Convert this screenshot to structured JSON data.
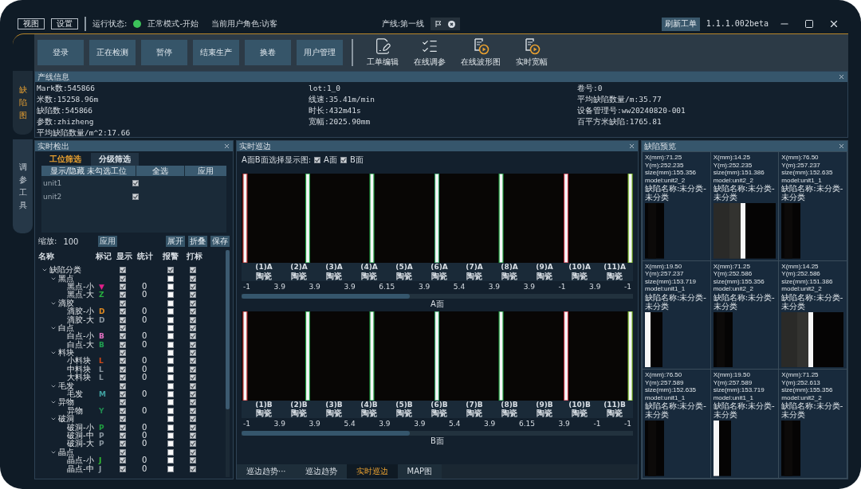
{
  "menu": [
    "视图",
    "设置"
  ],
  "status": {
    "label": "运行状态:",
    "state": "正常模式-开始",
    "running": true
  },
  "role": "当前用户角色:访客",
  "line": "产线:第一线",
  "refresh_button": "刷新工单",
  "version": "1.1.1.002beta",
  "actions": [
    "登录",
    "正在检测",
    "暂停",
    "结束生产",
    "换卷",
    "用户管理"
  ],
  "tools": [
    {
      "label": "工单编辑",
      "kind": "edit"
    },
    {
      "label": "在线调参",
      "kind": "list"
    },
    {
      "label": "在线波形图",
      "kind": "play"
    },
    {
      "label": "实时宽幅",
      "kind": "play"
    }
  ],
  "side_tabs": [
    {
      "label": "缺陷图",
      "selected": true
    },
    {
      "label": "调参工具",
      "selected": false
    }
  ],
  "info": {
    "title": "产线信息",
    "columns": [
      [
        "Mark数:545866",
        "米数:15258.96m",
        "缺陷数:545866",
        "参数:zhizheng",
        "平均缺陷数量/m^2:17.66"
      ],
      [
        "lot:1_0",
        "线速:35.41m/min",
        "时长:432m41s",
        "宽幅:2025.90mm"
      ],
      [
        "卷号:0",
        "平均缺陷数量/m:35.77",
        "设备管理号:ww20240820-001",
        "百平方米缺陷:1765.81"
      ]
    ]
  },
  "detect": {
    "title": "实时检出",
    "tabs": [
      {
        "label": "工位筛选",
        "selected": true
      },
      {
        "label": "分级筛选",
        "selected": false
      }
    ],
    "filter_columns": [
      "显示/隐藏 未勾选工位",
      "全选",
      "应用"
    ],
    "units": [
      {
        "name": "unit1",
        "checked": true
      },
      {
        "name": "unit2",
        "checked": true
      }
    ],
    "zoom_label": "缩放:",
    "zoom_value": "100",
    "zoom_apply": "应用",
    "buttons": [
      "展开",
      "折叠",
      "保存"
    ],
    "tree_columns": [
      "名称",
      "标记",
      "显示",
      "统计",
      "报警",
      "打标"
    ],
    "tree": [
      {
        "name": "缺陷分类",
        "expanded": true,
        "show": true,
        "alarm": true,
        "mark": true,
        "children": [
          {
            "name": "黑点",
            "expanded": true,
            "show": true,
            "alarm": false,
            "mark": true,
            "children": [
              {
                "name": "黑点-小",
                "symbol": "▼",
                "color": "#e0208a",
                "count": "0",
                "show": true,
                "alarm": false,
                "mark": true
              },
              {
                "name": "黑点-大",
                "symbol": "Z",
                "color": "#28b040",
                "count": "0",
                "show": true,
                "alarm": false,
                "mark": true
              }
            ]
          },
          {
            "name": "滴胶",
            "expanded": true,
            "show": true,
            "alarm": false,
            "mark": true,
            "children": [
              {
                "name": "滴胶-小",
                "symbol": "D",
                "color": "#e08a20",
                "count": "0",
                "show": true,
                "alarm": false,
                "mark": true
              },
              {
                "name": "滴胶-大",
                "symbol": "D",
                "color": "#8a96a0",
                "count": "0",
                "show": true,
                "alarm": false,
                "mark": true
              }
            ]
          },
          {
            "name": "白点",
            "expanded": true,
            "show": true,
            "alarm": false,
            "mark": true,
            "children": [
              {
                "name": "白点-小",
                "symbol": "B",
                "color": "#e070c0",
                "count": "0",
                "show": true,
                "alarm": false,
                "mark": true
              },
              {
                "name": "白点-大",
                "symbol": "B",
                "color": "#20a050",
                "count": "0",
                "show": true,
                "alarm": false,
                "mark": true
              }
            ]
          },
          {
            "name": "料块",
            "expanded": true,
            "show": true,
            "alarm": false,
            "mark": true,
            "children": [
              {
                "name": "小料块",
                "symbol": "L",
                "color": "#d04818",
                "count": "0",
                "show": true,
                "alarm": false,
                "mark": true
              },
              {
                "name": "中料块",
                "symbol": "L",
                "color": "#8a96a0",
                "count": "0",
                "show": true,
                "alarm": false,
                "mark": true
              },
              {
                "name": "大料块",
                "symbol": "L",
                "color": "#8a96a0",
                "count": "0",
                "show": true,
                "alarm": false,
                "mark": true
              }
            ]
          },
          {
            "name": "毛发",
            "expanded": true,
            "show": true,
            "alarm": false,
            "mark": true,
            "children": [
              {
                "name": "毛发",
                "symbol": "M",
                "color": "#40a0a0",
                "count": "0",
                "show": true,
                "alarm": false,
                "mark": true
              }
            ]
          },
          {
            "name": "异物",
            "expanded": true,
            "show": true,
            "alarm": false,
            "mark": true,
            "children": [
              {
                "name": "异物",
                "symbol": "Y",
                "color": "#208a50",
                "count": "0",
                "show": true,
                "alarm": false,
                "mark": true
              }
            ]
          },
          {
            "name": "破洞",
            "expanded": true,
            "show": true,
            "alarm": false,
            "mark": true,
            "children": [
              {
                "name": "破洞-小",
                "symbol": "P",
                "color": "#20a040",
                "count": "0",
                "show": true,
                "alarm": false,
                "mark": true
              },
              {
                "name": "破洞-中",
                "symbol": "P",
                "color": "#8a96a0",
                "count": "0",
                "show": true,
                "alarm": false,
                "mark": true
              },
              {
                "name": "破洞-大",
                "symbol": "P",
                "color": "#8a96a0",
                "count": "0",
                "show": true,
                "alarm": false,
                "mark": true
              }
            ]
          },
          {
            "name": "晶点",
            "expanded": true,
            "show": true,
            "alarm": false,
            "mark": true,
            "children": [
              {
                "name": "晶点-小",
                "symbol": "J",
                "color": "#30c030",
                "count": "0",
                "show": true,
                "alarm": false,
                "mark": true
              },
              {
                "name": "晶点-中",
                "symbol": "J",
                "color": "#8a96a0",
                "count": "0",
                "show": true,
                "alarm": false,
                "mark": true
              }
            ]
          }
        ]
      }
    ]
  },
  "edge": {
    "title": "实时巡边",
    "select_label": "A面B面选择显示图:",
    "faces": [
      {
        "label": "A面",
        "checked": true
      },
      {
        "label": "B面",
        "checked": true
      }
    ],
    "strips": [
      {
        "caption": "A面",
        "labels": [
          [
            "(1)A",
            "陶瓷"
          ],
          [
            "(2)A",
            "陶瓷"
          ],
          [
            "(3)A",
            "陶瓷"
          ],
          [
            "(4)A",
            "陶瓷"
          ],
          [
            "(5)A",
            "陶瓷"
          ],
          [
            "(6)A",
            "陶瓷"
          ],
          [
            "(7)A",
            "陶瓷"
          ],
          [
            "(8)A",
            "陶瓷"
          ],
          [
            "(9)A",
            "陶瓷"
          ],
          [
            "(10)A",
            "陶瓷"
          ],
          [
            "(11)A",
            "陶瓷"
          ]
        ],
        "values": [
          "-1",
          "3.9",
          "3.9",
          "3.9",
          "6.15",
          "3.9",
          "5.4",
          "3.9",
          "3.9",
          "-1",
          "3.9",
          "-1"
        ]
      },
      {
        "caption": "B面",
        "labels": [
          [
            "(1)B",
            "陶瓷"
          ],
          [
            "(2)B",
            "陶瓷"
          ],
          [
            "(3)B",
            "陶瓷"
          ],
          [
            "(4)B",
            "陶瓷"
          ],
          [
            "(5)B",
            "陶瓷"
          ],
          [
            "(6)B",
            "陶瓷"
          ],
          [
            "(7)B",
            "陶瓷"
          ],
          [
            "(8)B",
            "陶瓷"
          ],
          [
            "(9)B",
            "陶瓷"
          ],
          [
            "(10)B",
            "陶瓷"
          ],
          [
            "(11)B",
            "陶瓷"
          ]
        ],
        "values": [
          "-1",
          "3.9",
          "3.9",
          "5.4",
          "3.9",
          "3.9",
          "5.4",
          "3.9",
          "6.15",
          "3.9",
          "-1",
          "-1"
        ]
      }
    ],
    "tabs": [
      {
        "label": "巡边趋势···",
        "selected": false
      },
      {
        "label": "巡边趋势",
        "selected": false
      },
      {
        "label": "实时巡边",
        "selected": true
      },
      {
        "label": "MAP图",
        "selected": false
      }
    ]
  },
  "preview": {
    "title": "缺陷预览",
    "items": [
      {
        "lines": [
          "X(mm):71.25",
          "Y(m):252.235",
          "size(mm):155.356",
          "model:unit2_2",
          "缺陷名称:未分类-未分类"
        ]
      },
      {
        "lines": [
          "X(mm):14.25",
          "Y(m):252.235",
          "size(mm):151.386",
          "model:unit2_2",
          "缺陷名称:未分类-未分类"
        ]
      },
      {
        "lines": [
          "X(mm):76.50",
          "Y(m):257.237",
          "size(mm):152.635",
          "model:unit1_1",
          "缺陷名称:未分类-未分类"
        ]
      },
      {
        "lines": [
          "X(mm):19.50",
          "Y(m):257.237",
          "size(mm):153.719",
          "model:unit1_1",
          "缺陷名称:未分类-未分类"
        ]
      },
      {
        "lines": [
          "X(mm):71.25",
          "Y(m):252.586",
          "size(mm):155.356",
          "model:unit2_2",
          "缺陷名称:未分类-未分类"
        ]
      },
      {
        "lines": [
          "X(mm):14.25",
          "Y(m):252.586",
          "size(mm):151.386",
          "model:unit2_2",
          "缺陷名称:未分类-未分类"
        ]
      },
      {
        "lines": [
          "X(mm):76.50",
          "Y(m):257.589",
          "size(mm):152.635",
          "model:unit1_1",
          "缺陷名称:未分类-未分类"
        ]
      },
      {
        "lines": [
          "X(mm):19.50",
          "Y(m):257.589",
          "size(mm):153.719",
          "model:unit1_1",
          "缺陷名称:未分类-未分类"
        ]
      },
      {
        "lines": [
          "X(mm):71.25",
          "Y(m):252.613",
          "size(mm):155.356",
          "model:unit2_2",
          "缺陷名称:未分类-未分类"
        ]
      }
    ]
  }
}
